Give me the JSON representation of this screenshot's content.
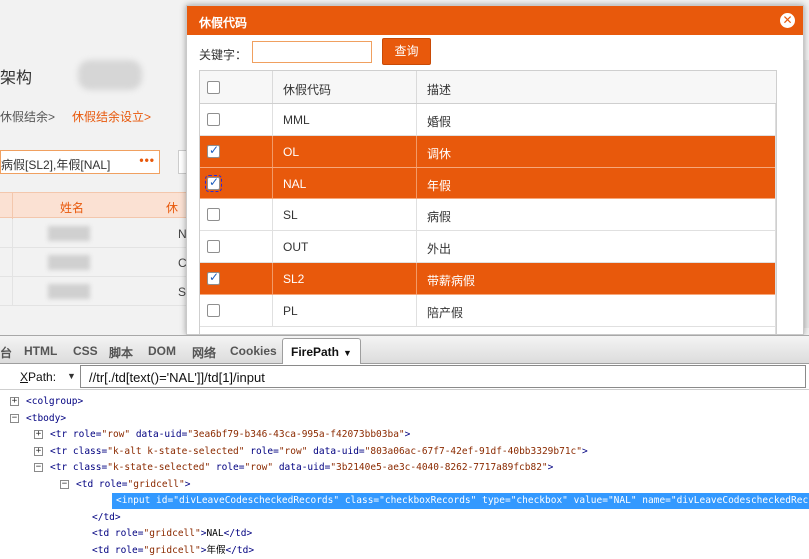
{
  "background": {
    "title": "架构",
    "breadcrumb": [
      "休假结余>",
      "休假结余设立>"
    ],
    "field_value": "病假[SL2],年假[NAL]",
    "field_dots": "•••",
    "grid_headers": [
      "姓名",
      "休"
    ],
    "grid_codes": [
      "N",
      "C",
      "S"
    ]
  },
  "dialog": {
    "title": "休假代码",
    "close_glyph": "✕",
    "search_label": "关键字：",
    "search_value": "",
    "search_button": "查询",
    "columns": [
      "",
      "休假代码",
      "描述"
    ],
    "rows": [
      {
        "code": "MML",
        "desc": "婚假",
        "checked": false,
        "selected": false
      },
      {
        "code": "OL",
        "desc": "调休",
        "checked": true,
        "selected": true
      },
      {
        "code": "NAL",
        "desc": "年假",
        "checked": true,
        "selected": true,
        "focused": true
      },
      {
        "code": "SL",
        "desc": "病假",
        "checked": false,
        "selected": false
      },
      {
        "code": "OUT",
        "desc": "外出",
        "checked": false,
        "selected": false
      },
      {
        "code": "SL2",
        "desc": "带薪病假",
        "checked": true,
        "selected": true
      },
      {
        "code": "PL",
        "desc": "陪产假",
        "checked": false,
        "selected": false
      }
    ],
    "selected_color": "#e8590c"
  },
  "firebug": {
    "tabs": [
      "台",
      "HTML",
      "CSS",
      "脚本",
      "DOM",
      "网络",
      "Cookies",
      "FirePath"
    ],
    "active_tab": "FirePath",
    "xpath_label_u": "X",
    "xpath_label_rest": "Path:",
    "xpath_value": "//tr[./td[text()='NAL']]/td[1]/input",
    "tree": [
      {
        "toggle": "+",
        "parts": [
          [
            "tag",
            "<colgroup>"
          ]
        ]
      },
      {
        "toggle": "−",
        "parts": [
          [
            "tag",
            "<tbody>"
          ]
        ]
      },
      {
        "toggle": "+",
        "parts": [
          [
            "tag",
            "<tr "
          ],
          [
            "attr",
            "role="
          ],
          [
            "aval",
            "\"row\" "
          ],
          [
            "attr",
            " data-uid="
          ],
          [
            "aval",
            "\"3ea6bf79-b346-43ca-995a-f42073bb03ba\""
          ],
          [
            "tag",
            ">"
          ]
        ]
      },
      {
        "toggle": "+",
        "parts": [
          [
            "tag",
            "<tr "
          ],
          [
            "attr",
            "class="
          ],
          [
            "aval",
            "\"k-alt k-state-selected\" "
          ],
          [
            "attr",
            " role="
          ],
          [
            "aval",
            "\"row\" "
          ],
          [
            "attr",
            " data-uid="
          ],
          [
            "aval",
            "\"803a06ac-67f7-42ef-91df-40bb3329b71c\""
          ],
          [
            "tag",
            ">"
          ]
        ]
      },
      {
        "toggle": "−",
        "parts": [
          [
            "tag",
            "<tr "
          ],
          [
            "attr",
            "class="
          ],
          [
            "aval",
            "\"k-state-selected\" "
          ],
          [
            "attr",
            " role="
          ],
          [
            "aval",
            "\"row\" "
          ],
          [
            "attr",
            " data-uid="
          ],
          [
            "aval",
            "\"3b2140e5-ae3c-4040-8262-7717a89fcb82\""
          ],
          [
            "tag",
            ">"
          ]
        ]
      },
      {
        "toggle": "−",
        "parts": [
          [
            "tag",
            "<td "
          ],
          [
            "attr",
            " role="
          ],
          [
            "aval",
            "\"gridcell\""
          ],
          [
            "tag",
            ">"
          ]
        ]
      },
      {
        "toggle": "",
        "parts": [
          [
            "tag",
            "<input "
          ],
          [
            "attr",
            " id="
          ],
          [
            "aval",
            "\"divLeaveCodescheckedRecords\" "
          ],
          [
            "attr",
            " class="
          ],
          [
            "aval",
            "\"checkboxRecords\" "
          ],
          [
            "attr",
            " type="
          ],
          [
            "aval",
            "\"checkbox\" "
          ],
          [
            "attr",
            " value="
          ],
          [
            "aval",
            "\"NAL\" "
          ],
          [
            "attr",
            " name="
          ],
          [
            "aval",
            "\"divLeaveCodescheckedRec"
          ]
        ]
      },
      {
        "toggle": "",
        "parts": [
          [
            "tag",
            "</td>"
          ]
        ]
      },
      {
        "toggle": "",
        "parts": [
          [
            "tag",
            "<td "
          ],
          [
            "attr",
            " role="
          ],
          [
            "aval",
            "\"gridcell\""
          ],
          [
            "tag",
            ">"
          ],
          [
            "ttext",
            "NAL"
          ],
          [
            "tag",
            "</td>"
          ]
        ]
      },
      {
        "toggle": "",
        "parts": [
          [
            "tag",
            "<td "
          ],
          [
            "attr",
            " role="
          ],
          [
            "aval",
            "\"gridcell\""
          ],
          [
            "tag",
            ">"
          ],
          [
            "ttext",
            "年假"
          ],
          [
            "tag",
            "</td>"
          ]
        ]
      }
    ]
  }
}
